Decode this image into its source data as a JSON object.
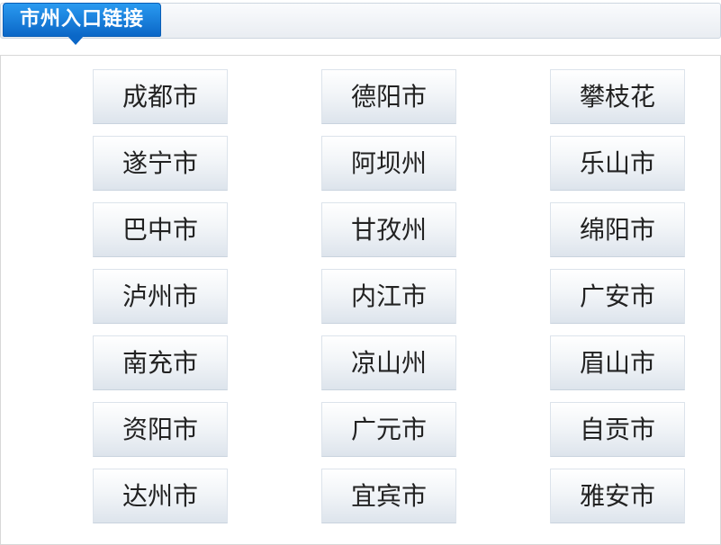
{
  "header": {
    "title": "市州入口链接"
  },
  "cities": {
    "rows": [
      [
        "成都市",
        "德阳市",
        "攀枝花"
      ],
      [
        "遂宁市",
        "阿坝州",
        "乐山市"
      ],
      [
        "巴中市",
        "甘孜州",
        "绵阳市"
      ],
      [
        "泸州市",
        "内江市",
        "广安市"
      ],
      [
        "南充市",
        "凉山州",
        "眉山市"
      ],
      [
        "资阳市",
        "广元市",
        "自贡市"
      ],
      [
        "达州市",
        "宜宾市",
        "雅安市"
      ]
    ]
  },
  "colors": {
    "tab_blue": "#1a7fdc",
    "button_text": "#222222"
  }
}
